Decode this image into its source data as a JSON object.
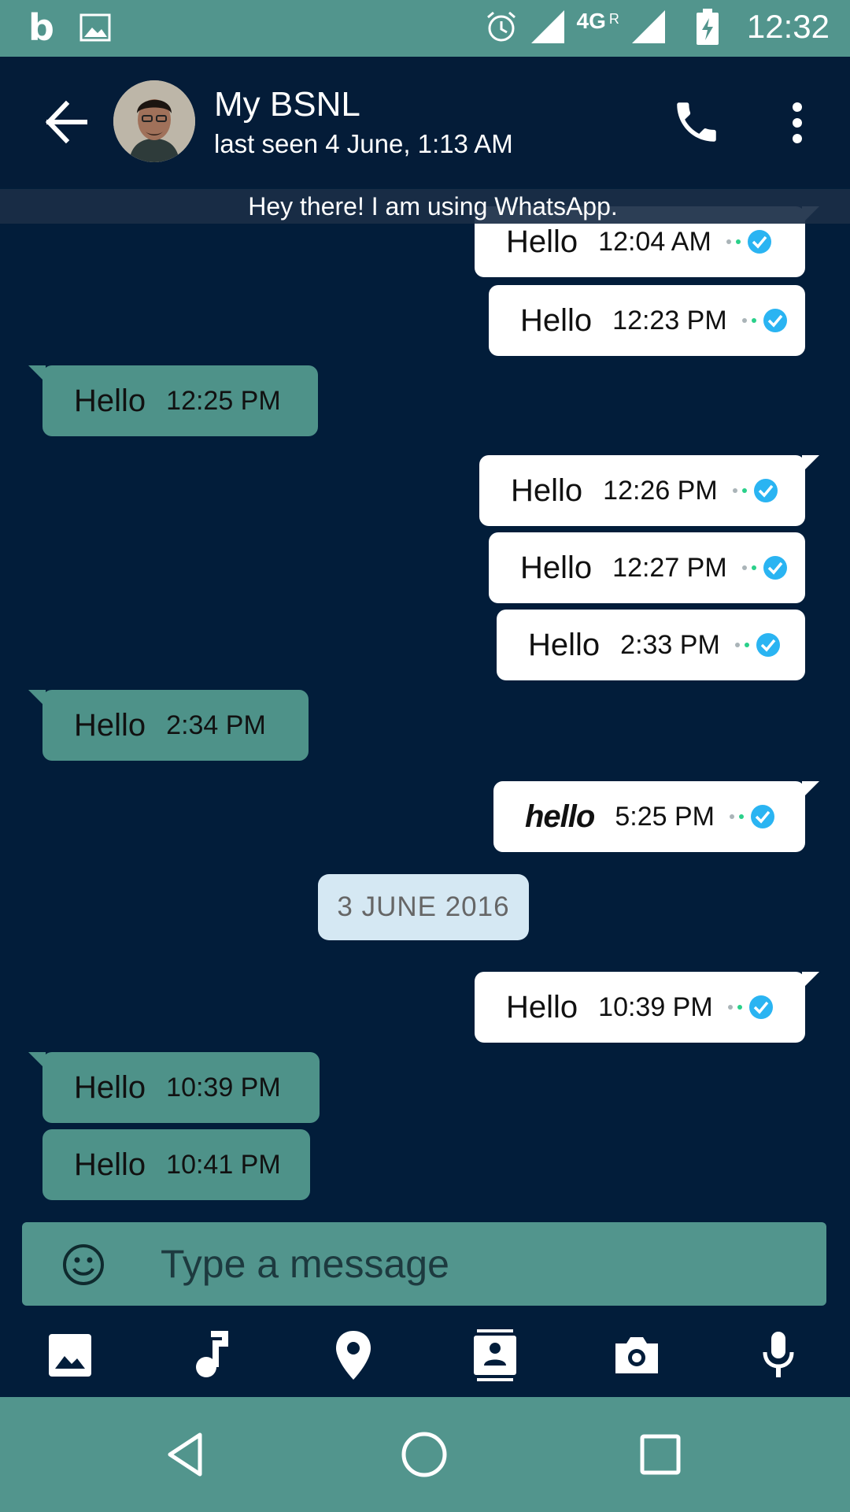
{
  "status_bar": {
    "left_letter": "b",
    "network": "4G",
    "roaming": "R",
    "time": "12:32",
    "icons": [
      "b-notification-icon",
      "gallery-icon",
      "alarm-icon",
      "signal-icon",
      "signal-roaming-icon",
      "battery-charging-icon"
    ]
  },
  "header": {
    "name": "My BSNL",
    "status": "last seen 4 June, 1:13 AM",
    "icons": [
      "back-arrow-icon",
      "contact-avatar",
      "phone-icon",
      "more-vertical-icon"
    ]
  },
  "about": {
    "text": "Hey there! I am using WhatsApp."
  },
  "messages": [
    {
      "dir": "out",
      "text": "Hello",
      "time": "12:04 AM"
    },
    {
      "dir": "out",
      "text": "Hello",
      "time": "12:23 PM"
    },
    {
      "dir": "in",
      "text": "Hello",
      "time": "12:25 PM"
    },
    {
      "dir": "out",
      "text": "Hello",
      "time": "12:26 PM"
    },
    {
      "dir": "out",
      "text": "Hello",
      "time": "12:27 PM"
    },
    {
      "dir": "out",
      "text": "Hello",
      "time": "2:33 PM"
    },
    {
      "dir": "in",
      "text": "Hello",
      "time": "2:34 PM"
    },
    {
      "dir": "out",
      "text": "hello",
      "time": "5:25 PM"
    },
    {
      "dir": "out",
      "text": "Hello",
      "time": "10:39 PM"
    },
    {
      "dir": "in",
      "text": "Hello",
      "time": "10:39 PM"
    },
    {
      "dir": "in",
      "text": "Hello",
      "time": "10:41 PM"
    }
  ],
  "date_separator": "3 JUNE 2016",
  "compose": {
    "placeholder": "Type a message",
    "attachments": [
      "gallery-icon",
      "music-icon",
      "location-icon",
      "contact-icon",
      "camera-icon",
      "mic-icon"
    ]
  },
  "nav": {
    "icons": [
      "back-triangle-icon",
      "home-circle-icon",
      "recents-square-icon"
    ]
  },
  "colors": {
    "accent": "#52958d",
    "background": "#021d3a",
    "header": "#041c38",
    "incoming_bubble": "#4e9289",
    "outgoing_bubble": "#ffffff",
    "tick_blue": "#2ab4f2",
    "date_pill": "#d5e8f3"
  }
}
